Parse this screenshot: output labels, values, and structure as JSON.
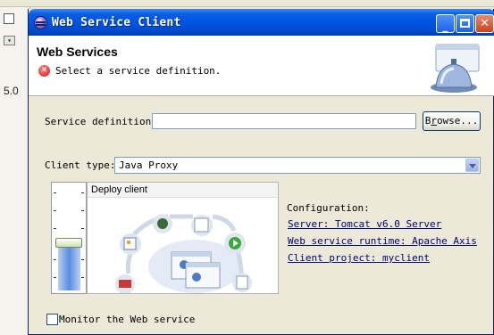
{
  "background": {
    "side_number": "5.0"
  },
  "window": {
    "title": "Web Service Client"
  },
  "banner": {
    "title": "Web Services",
    "message": "Select a service definition."
  },
  "form": {
    "service_definition_label": "Service definition:",
    "service_definition_value": "",
    "browse_label_prefix": "B",
    "browse_label_underlined": "r",
    "browse_label_rest": "owse...",
    "client_type_label": "Client type:",
    "client_type_value": "Java Proxy"
  },
  "slider": {
    "level_fraction": 0.45
  },
  "deploy": {
    "label": "Deploy client"
  },
  "configuration": {
    "title": "Configuration:",
    "server_link": "Server: Tomcat v6.0 Server",
    "runtime_link": "Web service runtime: Apache Axis",
    "project_link": "Client project: myclient"
  },
  "monitor": {
    "label": "Monitor the Web service",
    "checked": false
  },
  "colors": {
    "titlebar": "#0054e3",
    "link": "#00007a",
    "error": "#d11010"
  }
}
